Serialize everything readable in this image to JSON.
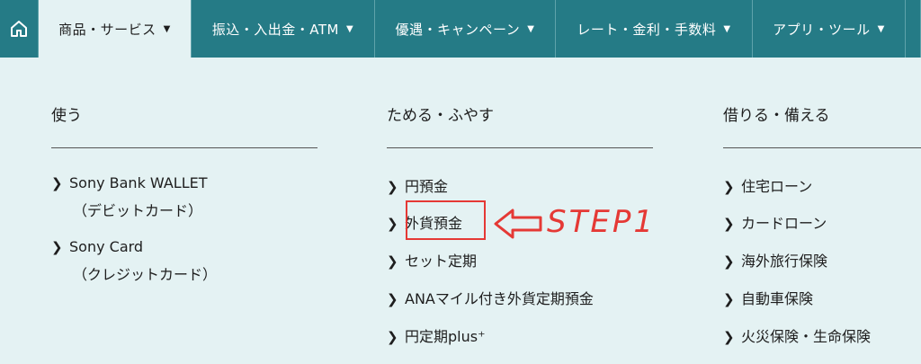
{
  "nav": {
    "tabs": [
      {
        "label": "商品・サービス"
      },
      {
        "label": "振込・入出金・ATM"
      },
      {
        "label": "優遇・キャンペーン"
      },
      {
        "label": "レート・金利・手数料"
      },
      {
        "label": "アプリ・ツール"
      }
    ],
    "caret": "▼"
  },
  "menu": {
    "columns": [
      {
        "heading": "使う",
        "items": [
          {
            "label": "Sony Bank WALLET",
            "sub": "（デビットカード）"
          },
          {
            "label": "Sony Card",
            "sub": "（クレジットカード）"
          }
        ]
      },
      {
        "heading": "ためる・ふやす",
        "items": [
          {
            "label": "円預金"
          },
          {
            "label": "外貨預金"
          },
          {
            "label": "セット定期"
          },
          {
            "label": "ANAマイル付き外貨定期預金"
          },
          {
            "label": "円定期plus⁺"
          }
        ]
      },
      {
        "heading": "借りる・備える",
        "items": [
          {
            "label": "住宅ローン"
          },
          {
            "label": "カードローン"
          },
          {
            "label": "海外旅行保険"
          },
          {
            "label": "自動車保険"
          },
          {
            "label": "火災保険・生命保険"
          }
        ]
      }
    ],
    "chevron": "❯"
  },
  "annotation": {
    "label": "STEP1",
    "color": "#e53935"
  },
  "colors": {
    "nav_bg": "#257b86",
    "panel_bg": "#e4f2f3"
  }
}
